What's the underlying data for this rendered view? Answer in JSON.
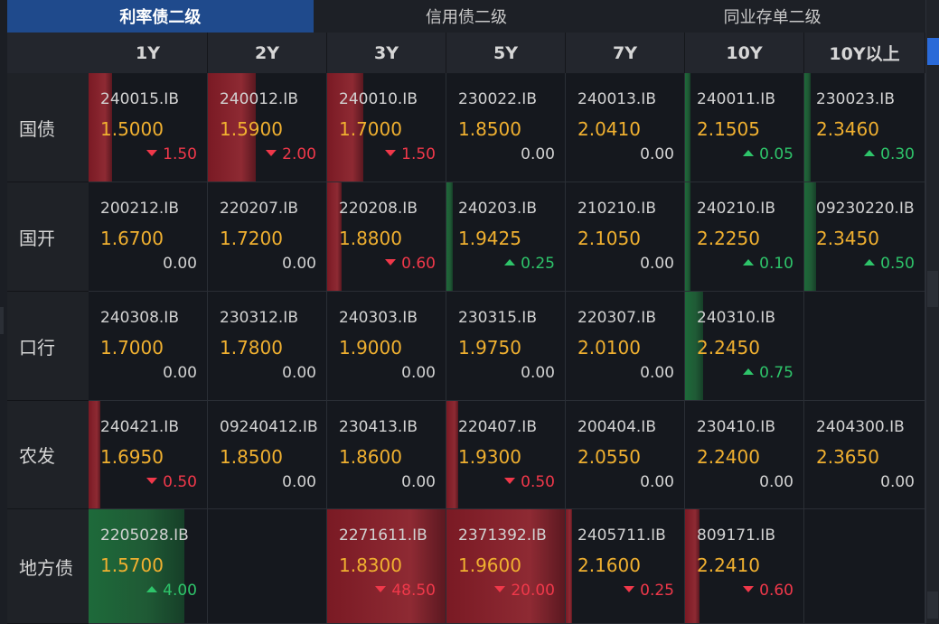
{
  "tabs": [
    {
      "label": "利率债二级",
      "active": true
    },
    {
      "label": "信用债二级",
      "active": false
    },
    {
      "label": "同业存单二级",
      "active": false
    }
  ],
  "columns": [
    "1Y",
    "2Y",
    "3Y",
    "5Y",
    "7Y",
    "10Y",
    "10Y以上"
  ],
  "colors": {
    "up": "#2ec46a",
    "down": "#f0384a",
    "yield": "#f0b030",
    "tab_active": "#1f4a8c"
  },
  "rows": [
    {
      "label": "国债",
      "cells": [
        {
          "code": "240015.IB",
          "yield": "1.5000",
          "change": "1.50",
          "dir": "down",
          "level": 0.2
        },
        {
          "code": "240012.IB",
          "yield": "1.5900",
          "change": "2.00",
          "dir": "down",
          "level": 0.4
        },
        {
          "code": "240010.IB",
          "yield": "1.7000",
          "change": "1.50",
          "dir": "down",
          "level": 0.3
        },
        {
          "code": "230022.IB",
          "yield": "1.8500",
          "change": "0.00",
          "dir": "zero",
          "level": 0
        },
        {
          "code": "240013.IB",
          "yield": "2.0410",
          "change": "0.00",
          "dir": "zero",
          "level": 0
        },
        {
          "code": "240011.IB",
          "yield": "2.1505",
          "change": "0.05",
          "dir": "up",
          "level": 0.02
        },
        {
          "code": "230023.IB",
          "yield": "2.3460",
          "change": "0.30",
          "dir": "up",
          "level": 0.05
        }
      ]
    },
    {
      "label": "国开",
      "cells": [
        {
          "code": "200212.IB",
          "yield": "1.6700",
          "change": "0.00",
          "dir": "zero",
          "level": 0
        },
        {
          "code": "220207.IB",
          "yield": "1.7200",
          "change": "0.00",
          "dir": "zero",
          "level": 0
        },
        {
          "code": "220208.IB",
          "yield": "1.8800",
          "change": "0.60",
          "dir": "down",
          "level": 0.12
        },
        {
          "code": "240203.IB",
          "yield": "1.9425",
          "change": "0.25",
          "dir": "up",
          "level": 0.05
        },
        {
          "code": "210210.IB",
          "yield": "2.1050",
          "change": "0.00",
          "dir": "zero",
          "level": 0
        },
        {
          "code": "240210.IB",
          "yield": "2.2250",
          "change": "0.10",
          "dir": "up",
          "level": 0.02
        },
        {
          "code": "09230220.IB",
          "yield": "2.3450",
          "change": "0.50",
          "dir": "up",
          "level": 0.1
        }
      ]
    },
    {
      "label": "口行",
      "cells": [
        {
          "code": "240308.IB",
          "yield": "1.7000",
          "change": "0.00",
          "dir": "zero",
          "level": 0
        },
        {
          "code": "230312.IB",
          "yield": "1.7800",
          "change": "0.00",
          "dir": "zero",
          "level": 0
        },
        {
          "code": "240303.IB",
          "yield": "1.9000",
          "change": "0.00",
          "dir": "zero",
          "level": 0
        },
        {
          "code": "230315.IB",
          "yield": "1.9750",
          "change": "0.00",
          "dir": "zero",
          "level": 0
        },
        {
          "code": "220307.IB",
          "yield": "2.0100",
          "change": "0.00",
          "dir": "zero",
          "level": 0
        },
        {
          "code": "240310.IB",
          "yield": "2.2450",
          "change": "0.75",
          "dir": "up",
          "level": 0.15
        },
        null
      ]
    },
    {
      "label": "农发",
      "cells": [
        {
          "code": "240421.IB",
          "yield": "1.6950",
          "change": "0.50",
          "dir": "down",
          "level": 0.1
        },
        {
          "code": "09240412.IB",
          "yield": "1.8500",
          "change": "0.00",
          "dir": "zero",
          "level": 0
        },
        {
          "code": "230413.IB",
          "yield": "1.8600",
          "change": "0.00",
          "dir": "zero",
          "level": 0
        },
        {
          "code": "220407.IB",
          "yield": "1.9300",
          "change": "0.50",
          "dir": "down",
          "level": 0.1
        },
        {
          "code": "200404.IB",
          "yield": "2.0550",
          "change": "0.00",
          "dir": "zero",
          "level": 0
        },
        {
          "code": "230410.IB",
          "yield": "2.2400",
          "change": "0.00",
          "dir": "zero",
          "level": 0
        },
        {
          "code": "2404300.IB",
          "yield": "2.3650",
          "change": "0.00",
          "dir": "zero",
          "level": 0
        }
      ]
    },
    {
      "label": "地方债",
      "cells": [
        {
          "code": "2205028.IB",
          "yield": "1.5700",
          "change": "4.00",
          "dir": "up",
          "level": 0.8
        },
        null,
        {
          "code": "2271611.IB",
          "yield": "1.8300",
          "change": "48.50",
          "dir": "down",
          "level": 1.0
        },
        {
          "code": "2371392.IB",
          "yield": "1.9600",
          "change": "20.00",
          "dir": "down",
          "level": 1.0
        },
        {
          "code": "2405711.IB",
          "yield": "2.1600",
          "change": "0.25",
          "dir": "down",
          "level": 0.05
        },
        {
          "code": "809171.IB",
          "yield": "2.2410",
          "change": "0.60",
          "dir": "down",
          "level": 0.12
        },
        null
      ]
    }
  ]
}
